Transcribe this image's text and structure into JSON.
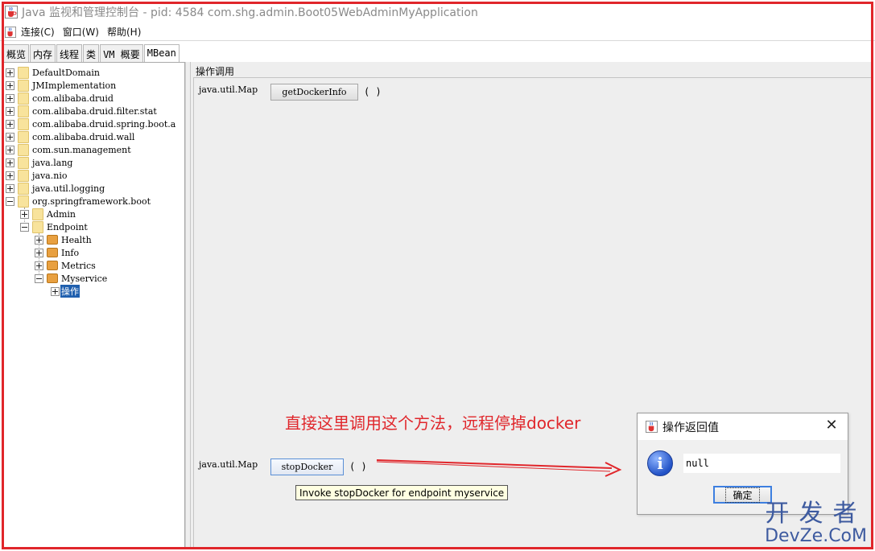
{
  "window": {
    "title": "Java 监视和管理控制台 - pid: 4584 com.shg.admin.Boot05WebAdminMyApplication"
  },
  "menu": [
    "连接(C)",
    "窗口(W)",
    "帮助(H)"
  ],
  "tabs": [
    "概览",
    "内存",
    "线程",
    "类",
    "VM 概要",
    "MBean"
  ],
  "tree": {
    "items": [
      {
        "label": "DefaultDomain"
      },
      {
        "label": "JMImplementation"
      },
      {
        "label": "com.alibaba.druid"
      },
      {
        "label": "com.alibaba.druid.filter.stat"
      },
      {
        "label": "com.alibaba.druid.spring.boot.a"
      },
      {
        "label": "com.alibaba.druid.wall"
      },
      {
        "label": "com.sun.management"
      },
      {
        "label": "java.lang"
      },
      {
        "label": "java.nio"
      },
      {
        "label": "java.util.logging"
      },
      {
        "label": "org.springframework.boot"
      },
      {
        "label": "Admin"
      },
      {
        "label": "Endpoint"
      },
      {
        "label": "Health"
      },
      {
        "label": "Info"
      },
      {
        "label": "Metrics"
      },
      {
        "label": "Myservice"
      },
      {
        "label": "操作"
      }
    ]
  },
  "operations": {
    "title": "操作调用",
    "items": [
      {
        "return_type": "java.util.Map",
        "name": "getDockerInfo",
        "params": "( )"
      },
      {
        "return_type": "java.util.Map",
        "name": "stopDocker",
        "params": "( )"
      }
    ],
    "tooltip": "Invoke stopDocker for endpoint myservice"
  },
  "annotation": "直接这里调用这个方法，远程停掉docker",
  "dialog": {
    "title": "操作返回值",
    "close": "✕",
    "info_glyph": "i",
    "value": "null",
    "ok_label": "确定"
  },
  "watermark": {
    "line1": "开发者",
    "line2": "DevZe.CoM"
  },
  "colors": {
    "annotation": "#e0262b",
    "selection": "#1f5fae",
    "watermark": "#3d5a9f"
  }
}
